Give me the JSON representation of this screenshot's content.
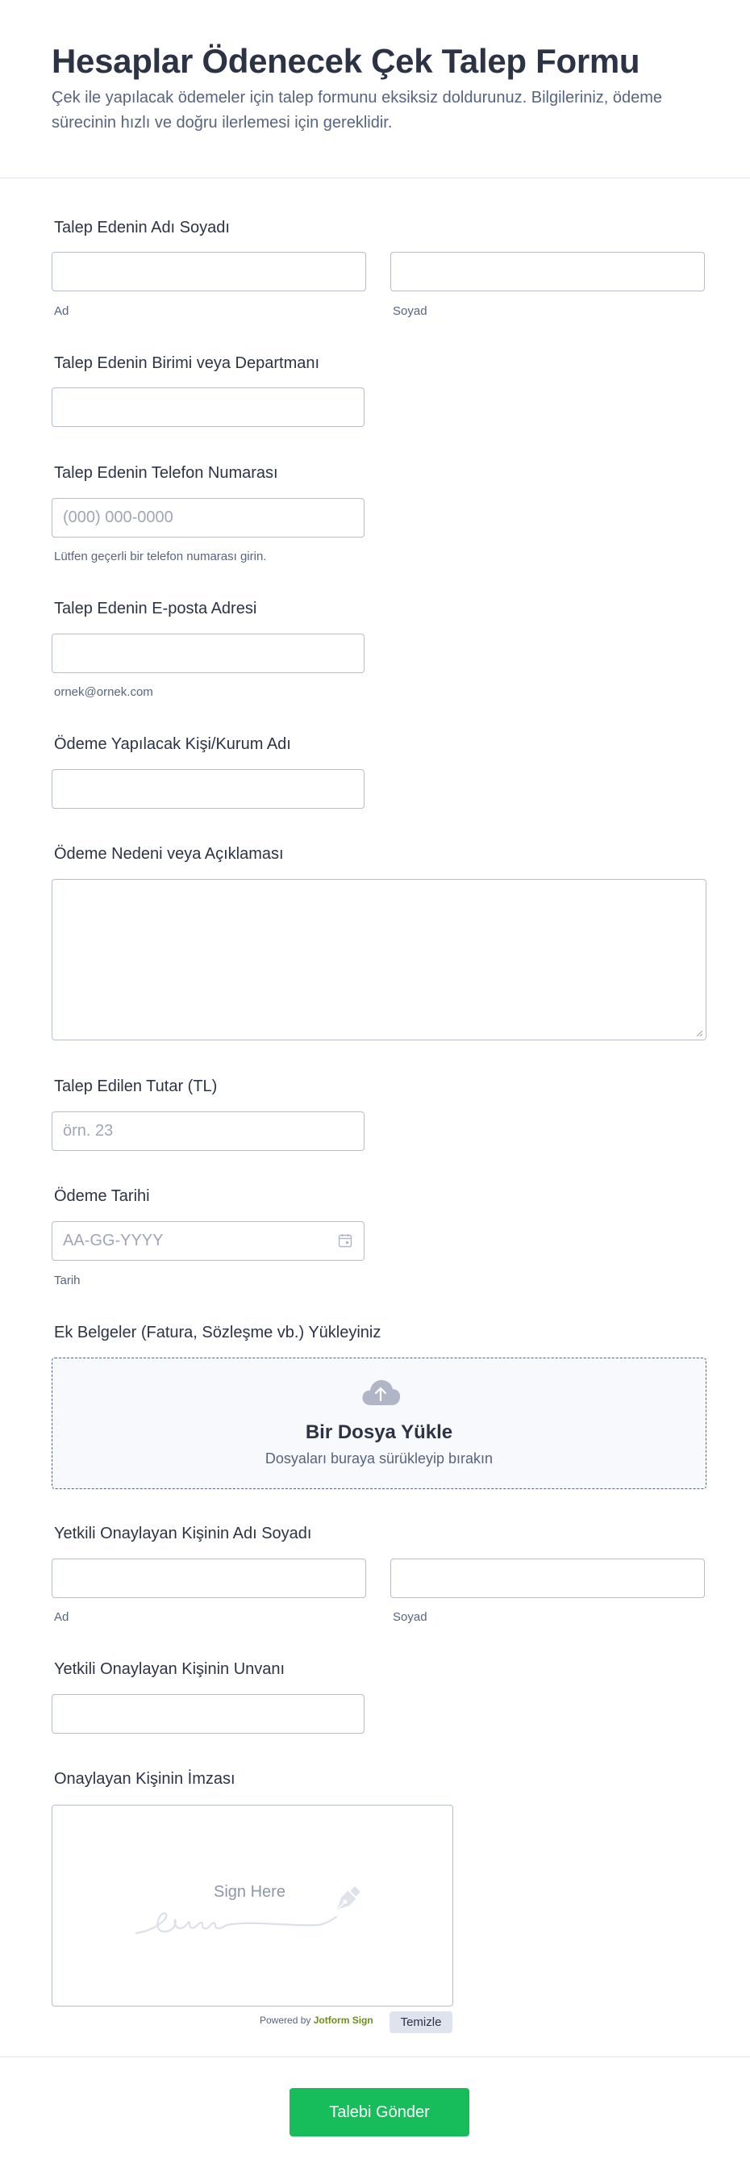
{
  "header": {
    "title": "Hesaplar Ödenecek Çek Talep Formu",
    "subtitle": "Çek ile yapılacak ödemeler için talep formunu eksiksiz doldurunuz. Bilgileriniz, ödeme sürecinin hızlı ve doğru ilerlemesi için gereklidir."
  },
  "fields": {
    "requester_name": {
      "label": "Talep Edenin Adı Soyadı",
      "first_sub": "Ad",
      "last_sub": "Soyad"
    },
    "department": {
      "label": "Talep Edenin Birimi veya Departmanı"
    },
    "phone": {
      "label": "Talep Edenin Telefon Numarası",
      "placeholder": "(000) 000-0000",
      "sub": "Lütfen geçerli bir telefon numarası girin."
    },
    "email": {
      "label": "Talep Edenin E-posta Adresi",
      "sub": "ornek@ornek.com"
    },
    "payee": {
      "label": "Ödeme Yapılacak Kişi/Kurum Adı"
    },
    "reason": {
      "label": "Ödeme Nedeni veya Açıklaması"
    },
    "amount": {
      "label": "Talep Edilen Tutar (TL)",
      "placeholder": "örn. 23"
    },
    "date": {
      "label": "Ödeme Tarihi",
      "placeholder": "AA-GG-YYYY",
      "sub": "Tarih",
      "icon": "calendar-icon"
    },
    "upload": {
      "label": "Ek Belgeler (Fatura, Sözleşme vb.) Yükleyiniz",
      "title": "Bir Dosya Yükle",
      "sub": "Dosyaları buraya sürükleyip bırakın",
      "icon": "cloud-upload-icon"
    },
    "approver_name": {
      "label": "Yetkili Onaylayan Kişinin Adı Soyadı",
      "first_sub": "Ad",
      "last_sub": "Soyad"
    },
    "approver_title": {
      "label": "Yetkili Onaylayan Kişinin Unvanı"
    },
    "signature": {
      "label": "Onaylayan Kişinin İmzası",
      "placeholder": "Sign Here",
      "powered_prefix": "Powered by",
      "powered_brand": "Jotform Sign",
      "clear_label": "Temizle",
      "icon": "pen-icon"
    }
  },
  "submit": {
    "label": "Talebi Gönder"
  },
  "colors": {
    "accent": "#18bd5b",
    "text": "#2c3345",
    "muted": "#57647e",
    "border": "#b8bdc9"
  }
}
